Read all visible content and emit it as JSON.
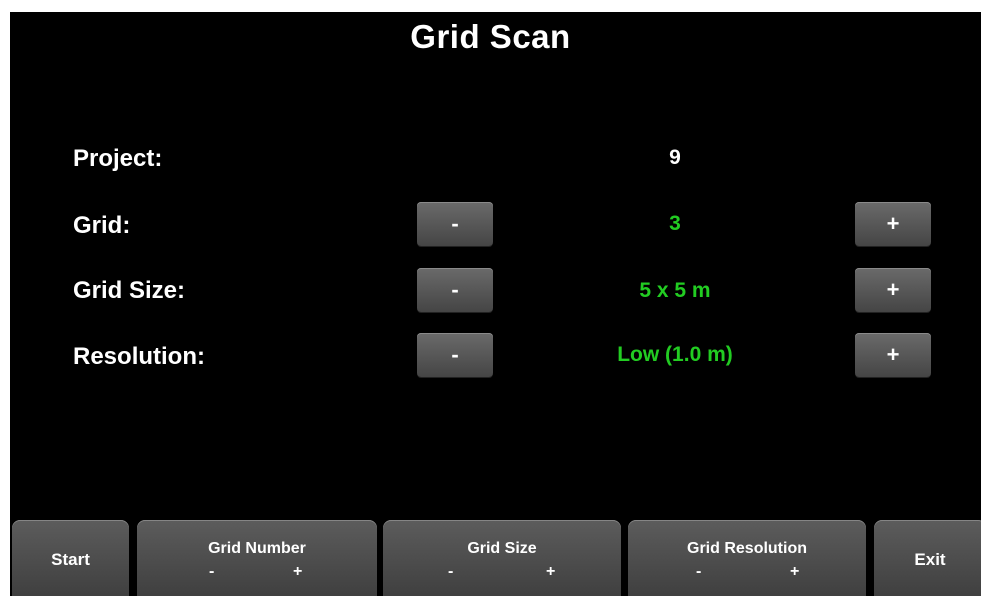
{
  "title": "Grid Scan",
  "rows": {
    "project": {
      "label": "Project:",
      "value": "9"
    },
    "grid": {
      "label": "Grid:",
      "value": "3"
    },
    "grid_size": {
      "label": "Grid Size:",
      "value": "5 x 5 m"
    },
    "resolution": {
      "label": "Resolution:",
      "value": "Low (1.0 m)"
    }
  },
  "controls": {
    "minus": "-",
    "plus": "+"
  },
  "bottom_bar": {
    "start": "Start",
    "grid_number": {
      "label": "Grid Number",
      "minus": "-",
      "plus": "+"
    },
    "grid_size": {
      "label": "Grid Size",
      "minus": "-",
      "plus": "+"
    },
    "grid_resolution": {
      "label": "Grid Resolution",
      "minus": "-",
      "plus": "+"
    },
    "exit": "Exit"
  },
  "colors": {
    "background": "#000000",
    "text": "#ffffff",
    "value_active": "#22cc22",
    "button": "#555555"
  }
}
